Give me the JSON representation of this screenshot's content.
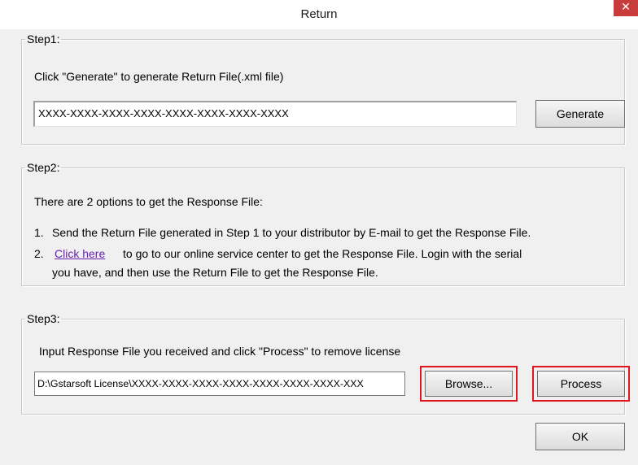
{
  "window": {
    "title": "Return",
    "close_glyph": "✕"
  },
  "step1": {
    "legend": "Step1:",
    "instruction": "Click \"Generate\" to generate Return File(.xml file)",
    "return_code": "XXXX-XXXX-XXXX-XXXX-XXXX-XXXX-XXXX-XXXX",
    "generate_label": "Generate"
  },
  "step2": {
    "legend": "Step2:",
    "intro": "There are 2 options to get the Response File:",
    "option1_num": "1.",
    "option1_text": "Send the Return File generated in Step 1 to your distributor by E-mail to get the Response File.",
    "option2_num": "2.",
    "option2_link": "Click here",
    "option2_text_line1": "to go to our online service center to get the Response File. Login with the serial",
    "option2_text_line2": "you have, and then use the Return File to get the Response File."
  },
  "step3": {
    "legend": "Step3:",
    "instruction": "Input Response File you received and click \"Process\" to remove license",
    "path_value": "D:\\Gstarsoft License\\XXXX-XXXX-XXXX-XXXX-XXXX-XXXX-XXXX-XXX",
    "browse_label": "Browse...",
    "process_label": "Process"
  },
  "footer": {
    "ok_label": "OK"
  },
  "colors": {
    "highlight": "#e0161c",
    "link": "#6a1fb0",
    "close_bg": "#c83c3c"
  }
}
